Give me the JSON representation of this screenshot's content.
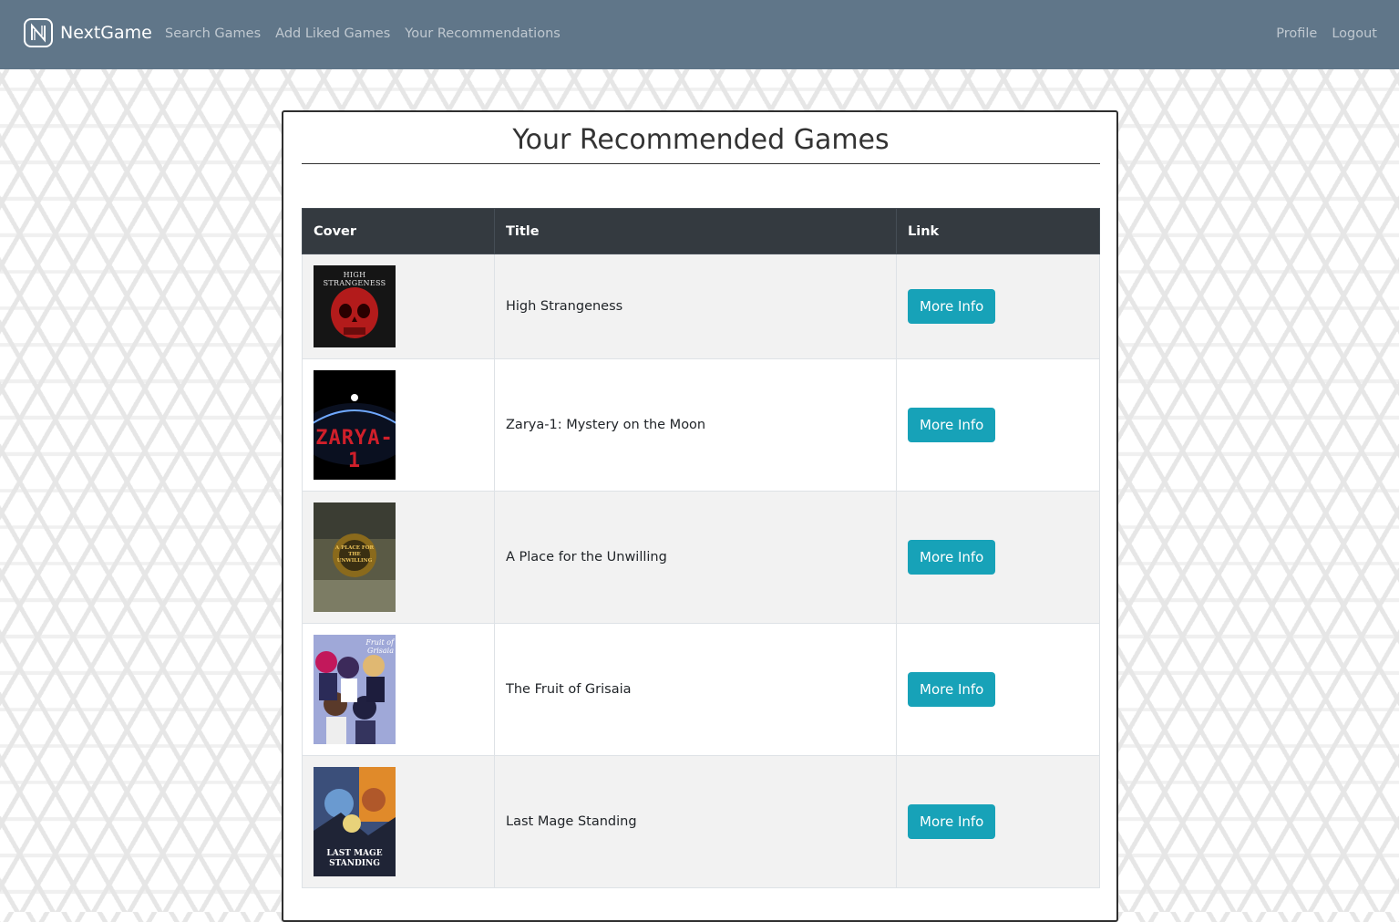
{
  "navbar": {
    "brand": "NextGame",
    "links": [
      "Search Games",
      "Add Liked Games",
      "Your Recommendations"
    ],
    "right_links": [
      "Profile",
      "Logout"
    ],
    "background_color": "#607689"
  },
  "main": {
    "title": "Your Recommended Games",
    "table": {
      "headers": [
        "Cover",
        "Title",
        "Link"
      ],
      "rows": [
        {
          "title": "High Strangeness",
          "button": "More Info",
          "cover_text": "HIGH STRANGENESS"
        },
        {
          "title": "Zarya-1: Mystery on the Moon",
          "button": "More Info",
          "cover_text": "ZARYA-1"
        },
        {
          "title": "A Place for the Unwilling",
          "button": "More Info",
          "cover_text": "A PLACE FOR THE UNWILLING"
        },
        {
          "title": "The Fruit of Grisaia",
          "button": "More Info",
          "cover_text": "Fruit of Grisaia"
        },
        {
          "title": "Last Mage Standing",
          "button": "More Info",
          "cover_text": "LAST MAGE STANDING"
        }
      ]
    }
  },
  "colors": {
    "button": "#17a2b8",
    "table_header": "#343a40"
  }
}
